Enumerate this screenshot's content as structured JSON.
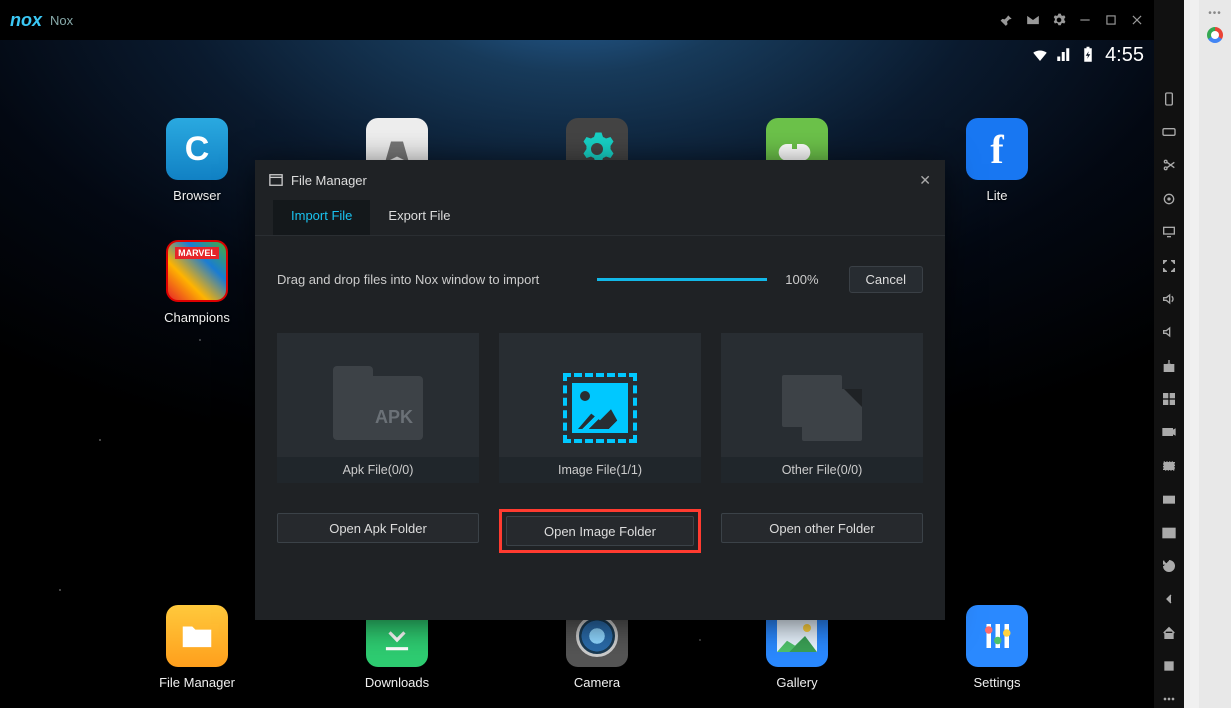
{
  "app": {
    "title": "Nox",
    "logo_text": "nox"
  },
  "statusbar": {
    "time": "4:55"
  },
  "desktop": {
    "top_row": [
      {
        "id": "browser",
        "label": "Browser"
      },
      {
        "id": "play",
        "label": ""
      },
      {
        "id": "settings",
        "label": ""
      },
      {
        "id": "game",
        "label": ""
      },
      {
        "id": "lite",
        "label": "Lite"
      }
    ],
    "champions": {
      "label": "Champions"
    },
    "bottom_row": [
      {
        "id": "filemgr",
        "label": "File Manager"
      },
      {
        "id": "downloads",
        "label": "Downloads"
      },
      {
        "id": "camera",
        "label": "Camera"
      },
      {
        "id": "gallery",
        "label": "Gallery"
      },
      {
        "id": "settings2",
        "label": "Settings"
      }
    ]
  },
  "dialog": {
    "title": "File Manager",
    "tabs": {
      "import": "Import File",
      "export": "Export File"
    },
    "hint": "Drag and drop files into Nox window to import",
    "progress_pct": "100%",
    "cancel": "Cancel",
    "cards": {
      "apk": {
        "title": "Apk File(0/0)",
        "open": "Open Apk Folder",
        "badge": "APK"
      },
      "image": {
        "title": "Image File(1/1)",
        "open": "Open Image Folder"
      },
      "other": {
        "title": "Other File(0/0)",
        "open": "Open other Folder"
      }
    }
  }
}
